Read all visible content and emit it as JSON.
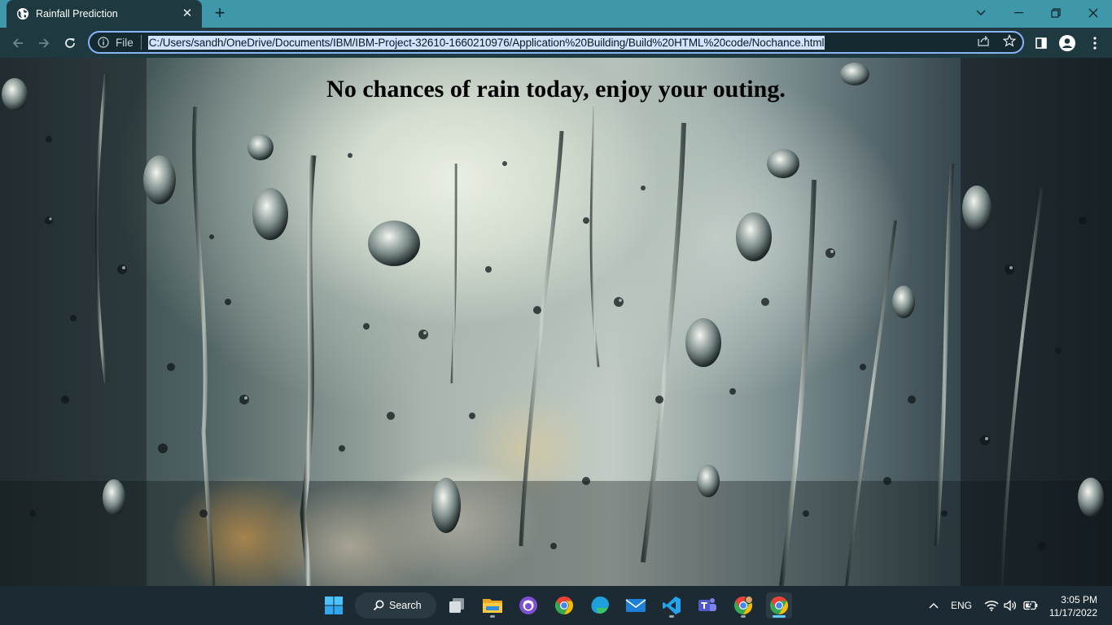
{
  "browser": {
    "tab": {
      "title": "Rainfall Prediction",
      "close_glyph": "✕",
      "icon": "globe-icon"
    },
    "new_tab_glyph": "+",
    "window_controls": [
      "chevron-down-icon",
      "minimize-icon",
      "restore-icon",
      "close-icon"
    ],
    "omnibox": {
      "scheme_label": "File",
      "url": "C:/Users/sandh/OneDrive/Documents/IBM/IBM-Project-32610-1660210976/Application%20Building/Build%20HTML%20code/Nochance.html"
    },
    "nav_icons": [
      "back-icon",
      "forward-icon",
      "reload-icon"
    ],
    "toolbar_icons": [
      "share-icon",
      "bookmark-star-icon",
      "side-panel-icon",
      "profile-icon",
      "menu-icon"
    ]
  },
  "page": {
    "heading": "No chances of rain today, enjoy your outing.",
    "background": "rain-on-window-photo"
  },
  "taskbar": {
    "search_label": "Search",
    "apps": [
      "windows-start-icon",
      "task-view-icon",
      "file-explorer-icon",
      "github-desktop-icon",
      "chrome-icon",
      "edge-icon",
      "mail-icon",
      "vscode-icon",
      "teams-icon",
      "chrome-profile-icon",
      "chrome-active-icon"
    ],
    "tray": {
      "language": "ENG",
      "time": "3:05 PM",
      "date": "11/17/2022"
    }
  },
  "colors": {
    "titlebar": "#3f97aa",
    "toolbar": "#1e3940",
    "taskbar": "#1c2b33",
    "url_highlight": "#d3e3fd",
    "active_indicator": "#60cdff"
  }
}
